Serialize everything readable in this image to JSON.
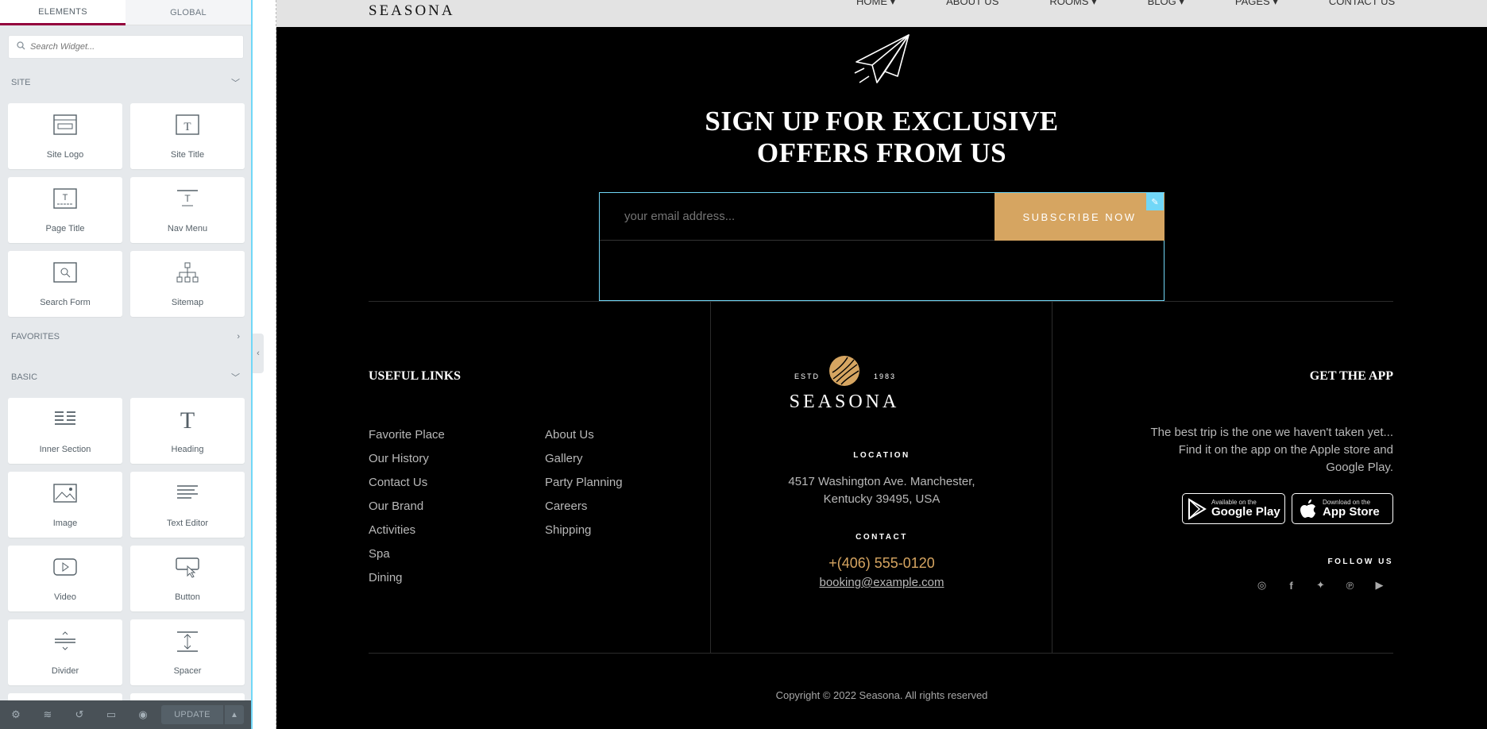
{
  "editor": {
    "tabs": [
      "ELEMENTS",
      "GLOBAL"
    ],
    "search_placeholder": "Search Widget...",
    "categories": {
      "site": "SITE",
      "favorites": "FAVORITES",
      "basic": "BASIC"
    },
    "site_widgets": [
      "Site Logo",
      "Site Title",
      "Page Title",
      "Nav Menu",
      "Search Form",
      "Sitemap"
    ],
    "basic_widgets": [
      "Inner Section",
      "Heading",
      "Image",
      "Text Editor",
      "Video",
      "Button",
      "Divider",
      "Spacer"
    ],
    "update_label": "UPDATE"
  },
  "site": {
    "header_logo": "SEASONA",
    "nav": [
      "HOME ▾",
      "ABOUT US",
      "ROOMS ▾",
      "BLOG ▾",
      "PAGES ▾",
      "CONTACT US"
    ],
    "headline_line1": "SIGN UP FOR EXCLUSIVE",
    "headline_line2": "OFFERS FROM US",
    "email_placeholder": "your email address...",
    "subscribe_label": "SUBSCRIBE NOW",
    "accent_color": "#d6a561",
    "useful_links_title": "USEFUL LINKS",
    "links_col1": [
      "Favorite Place",
      "Our History",
      "Contact Us",
      "Our Brand",
      "Activities",
      "Spa",
      "Dining"
    ],
    "links_col2": [
      "About Us",
      "Gallery",
      "Party Planning",
      "Careers",
      "Shipping"
    ],
    "footer_logo": {
      "estd": "ESTD",
      "year": "1983",
      "name": "SEASONA"
    },
    "location_label": "LOCATION",
    "address_line1": "4517 Washington Ave. Manchester,",
    "address_line2": "Kentucky 39495, USA",
    "contact_label": "CONTACT",
    "phone": "+(406) 555-0120",
    "email": "booking@example.com",
    "app_title": "GET THE APP",
    "app_text": "The best trip is the one we haven't taken yet... Find it on the app on the Apple store and Google Play.",
    "google_play": {
      "small": "Available on the",
      "big": "Google Play"
    },
    "app_store": {
      "small": "Download on the",
      "big": "App Store"
    },
    "follow_label": "FOLLOW US",
    "copyright": "Copyright © 2022 Seasona. All rights reserved"
  }
}
